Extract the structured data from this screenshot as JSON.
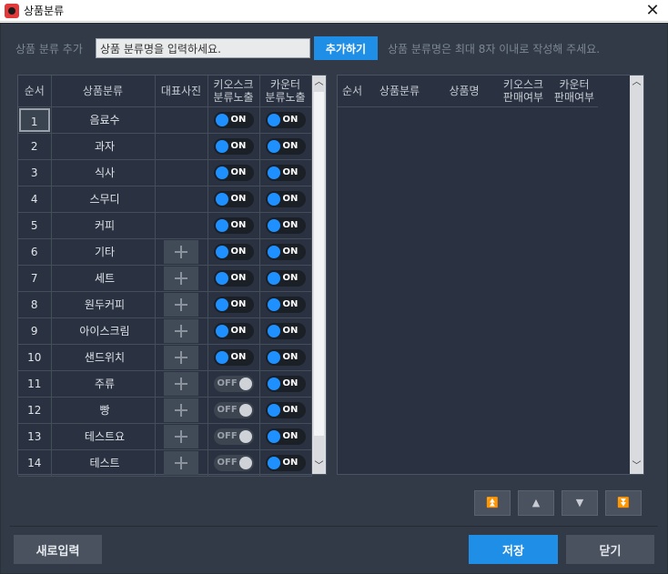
{
  "window": {
    "title": "상품분류"
  },
  "add_bar": {
    "label": "상품 분류 추가",
    "input_value": "상품 분류명을 입력하세요.",
    "button": "추가하기",
    "hint": "상품 분류명은 최대 8자 이내로 작성해 주세요."
  },
  "left_table": {
    "headers": {
      "no": "순서",
      "category": "상품분류",
      "photo": "대표사진",
      "kiosk_1": "키오스크",
      "kiosk_2": "분류노출",
      "counter_1": "카운터",
      "counter_2": "분류노출"
    },
    "rows": [
      {
        "no": "1",
        "name": "음료수",
        "photo": false,
        "kiosk": "ON",
        "counter": "ON"
      },
      {
        "no": "2",
        "name": "과자",
        "photo": false,
        "kiosk": "ON",
        "counter": "ON"
      },
      {
        "no": "3",
        "name": "식사",
        "photo": false,
        "kiosk": "ON",
        "counter": "ON"
      },
      {
        "no": "4",
        "name": "스무디",
        "photo": false,
        "kiosk": "ON",
        "counter": "ON"
      },
      {
        "no": "5",
        "name": "커피",
        "photo": false,
        "kiosk": "ON",
        "counter": "ON"
      },
      {
        "no": "6",
        "name": "기타",
        "photo": true,
        "kiosk": "ON",
        "counter": "ON"
      },
      {
        "no": "7",
        "name": "세트",
        "photo": true,
        "kiosk": "ON",
        "counter": "ON"
      },
      {
        "no": "8",
        "name": "원두커피",
        "photo": true,
        "kiosk": "ON",
        "counter": "ON"
      },
      {
        "no": "9",
        "name": "아이스크림",
        "photo": true,
        "kiosk": "ON",
        "counter": "ON"
      },
      {
        "no": "10",
        "name": "샌드위치",
        "photo": true,
        "kiosk": "ON",
        "counter": "ON"
      },
      {
        "no": "11",
        "name": "주류",
        "photo": true,
        "kiosk": "OFF",
        "counter": "ON"
      },
      {
        "no": "12",
        "name": "빵",
        "photo": true,
        "kiosk": "OFF",
        "counter": "ON"
      },
      {
        "no": "13",
        "name": "테스트요",
        "photo": true,
        "kiosk": "OFF",
        "counter": "ON"
      },
      {
        "no": "14",
        "name": "테스트",
        "photo": true,
        "kiosk": "OFF",
        "counter": "ON"
      }
    ]
  },
  "right_table": {
    "headers": {
      "no": "순서",
      "category": "상품분류",
      "product": "상품명",
      "kiosk_1": "키오스크",
      "kiosk_2": "판매여부",
      "counter_1": "카운터",
      "counter_2": "판매여부"
    }
  },
  "move_buttons": {
    "top": "⏫",
    "up": "▲",
    "down": "▼",
    "bottom": "⏬"
  },
  "footer": {
    "new": "새로입력",
    "save": "저장",
    "close": "닫기"
  },
  "colors": {
    "accent": "#1f8ee6",
    "background": "#313a46",
    "toggle_on": "#1e90ff"
  }
}
